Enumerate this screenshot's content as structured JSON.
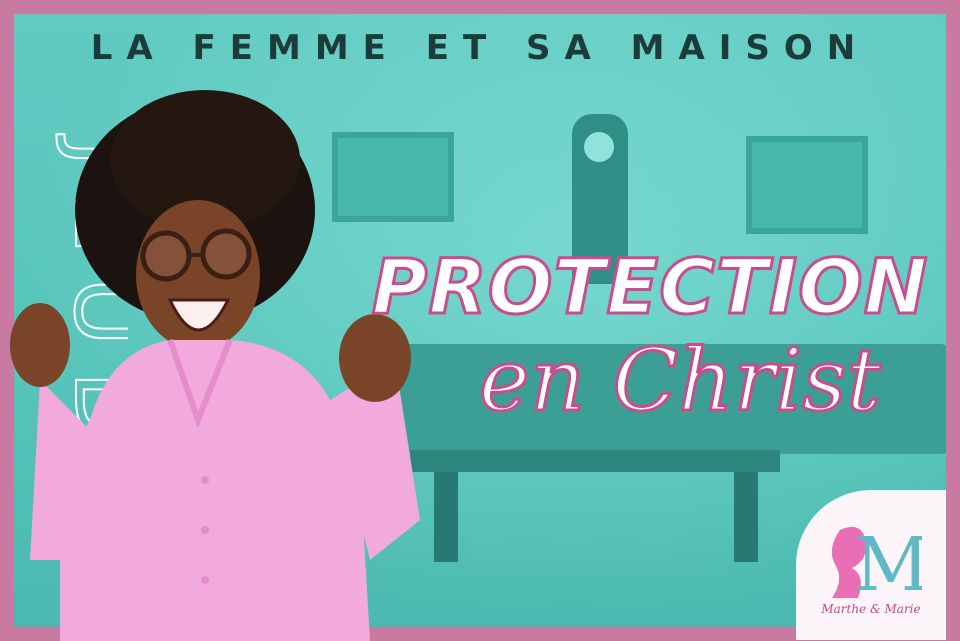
{
  "top_title": "LA FEMME ET SA MAISON",
  "side_word": "JEUDI",
  "headline": {
    "line1": "PROTECTION",
    "line2": "en Christ"
  },
  "logo": {
    "mark": "M",
    "text": "Marthe & Marie"
  },
  "colors": {
    "frame": "#c97aa0",
    "background": "#5bcfc4",
    "headline_fill": "#ffffff",
    "headline_stroke": "#c94d8c",
    "title": "#1d3b38"
  }
}
